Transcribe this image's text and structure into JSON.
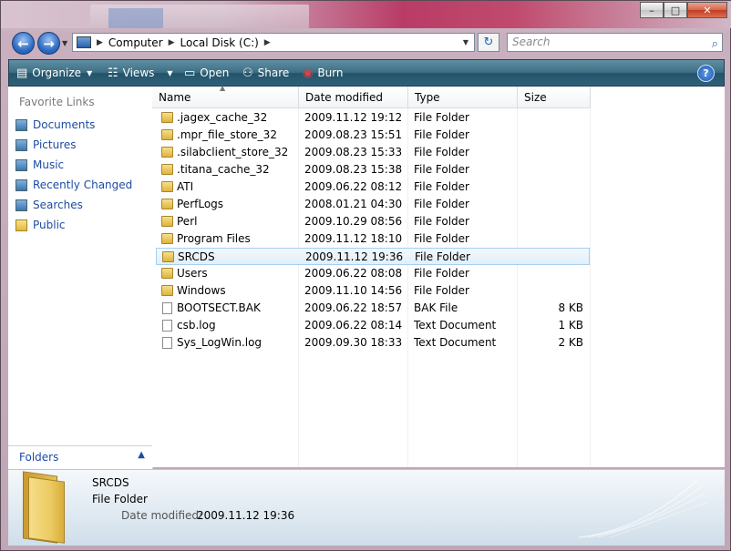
{
  "window": {
    "controls": {
      "minimize": "–",
      "maximize": "□",
      "close": "✕"
    }
  },
  "address": {
    "segments": [
      "Computer",
      "Local Disk (C:)"
    ],
    "search_placeholder": "Search"
  },
  "toolbar": {
    "organize": "Organize",
    "views": "Views",
    "open": "Open",
    "share": "Share",
    "burn": "Burn",
    "help": "?"
  },
  "nav": {
    "header": "Favorite Links",
    "items": [
      "Documents",
      "Pictures",
      "Music",
      "Recently Changed",
      "Searches",
      "Public"
    ],
    "folders_label": "Folders"
  },
  "columns": [
    "Name",
    "Date modified",
    "Type",
    "Size"
  ],
  "files": [
    {
      "name": ".jagex_cache_32",
      "date": "2009.11.12 19:12",
      "type": "File Folder",
      "size": "",
      "kind": "folder"
    },
    {
      "name": ".mpr_file_store_32",
      "date": "2009.08.23 15:51",
      "type": "File Folder",
      "size": "",
      "kind": "folder"
    },
    {
      "name": ".silabclient_store_32",
      "date": "2009.08.23 15:33",
      "type": "File Folder",
      "size": "",
      "kind": "folder"
    },
    {
      "name": ".titana_cache_32",
      "date": "2009.08.23 15:38",
      "type": "File Folder",
      "size": "",
      "kind": "folder"
    },
    {
      "name": "ATI",
      "date": "2009.06.22 08:12",
      "type": "File Folder",
      "size": "",
      "kind": "folder"
    },
    {
      "name": "PerfLogs",
      "date": "2008.01.21 04:30",
      "type": "File Folder",
      "size": "",
      "kind": "folder"
    },
    {
      "name": "Perl",
      "date": "2009.10.29 08:56",
      "type": "File Folder",
      "size": "",
      "kind": "folder"
    },
    {
      "name": "Program Files",
      "date": "2009.11.12 18:10",
      "type": "File Folder",
      "size": "",
      "kind": "folder"
    },
    {
      "name": "SRCDS",
      "date": "2009.11.12 19:36",
      "type": "File Folder",
      "size": "",
      "kind": "folder",
      "selected": true
    },
    {
      "name": "Users",
      "date": "2009.06.22 08:08",
      "type": "File Folder",
      "size": "",
      "kind": "folder"
    },
    {
      "name": "Windows",
      "date": "2009.11.10 14:56",
      "type": "File Folder",
      "size": "",
      "kind": "folder"
    },
    {
      "name": "BOOTSECT.BAK",
      "date": "2009.06.22 18:57",
      "type": "BAK File",
      "size": "8 KB",
      "kind": "file"
    },
    {
      "name": "csb.log",
      "date": "2009.06.22 08:14",
      "type": "Text Document",
      "size": "1 KB",
      "kind": "file"
    },
    {
      "name": "Sys_LogWin.log",
      "date": "2009.09.30 18:33",
      "type": "Text Document",
      "size": "2 KB",
      "kind": "file"
    }
  ],
  "details": {
    "name": "SRCDS",
    "type": "File Folder",
    "date_label": "Date modified:",
    "date_value": "2009.11.12 19:36"
  }
}
